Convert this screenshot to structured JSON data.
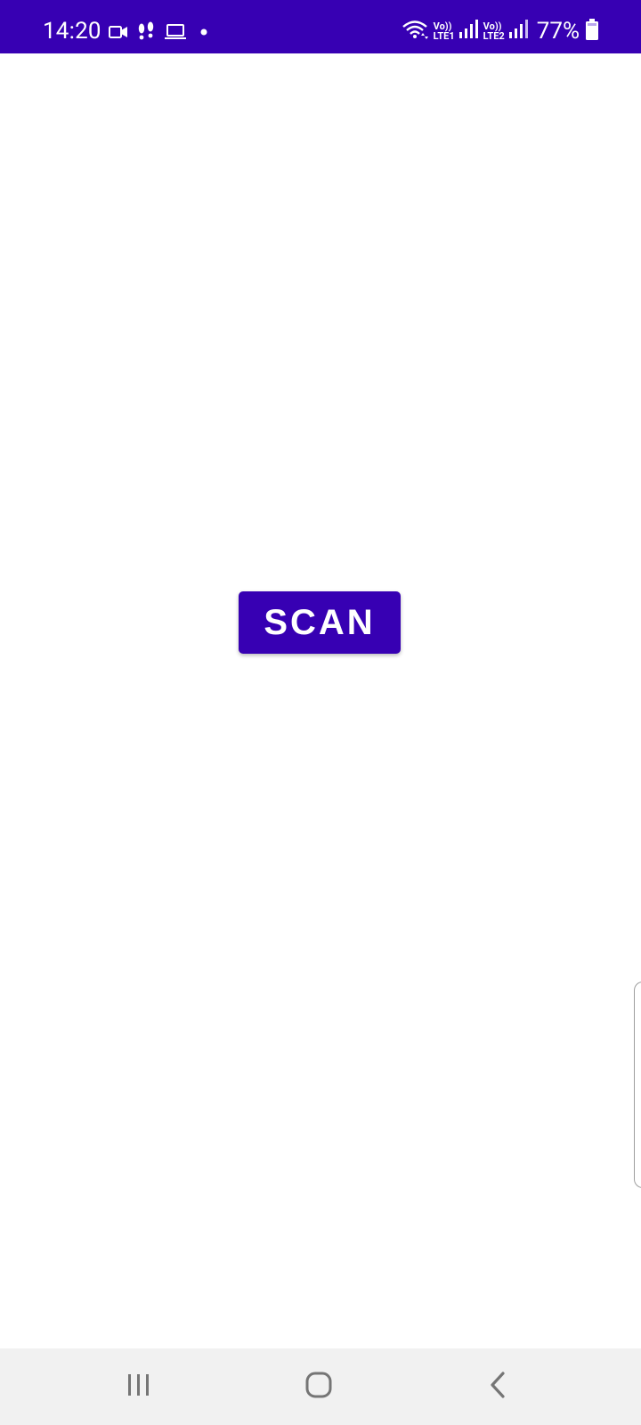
{
  "status_bar": {
    "time": "14:20",
    "lte1_top": "Vo))",
    "lte1_bottom": "LTE1",
    "lte2_top": "Vo))",
    "lte2_bottom": "LTE2",
    "battery_percent": "77%",
    "background": "#3700B3",
    "icons": [
      "video-camera-icon",
      "footsteps-icon",
      "laptop-icon",
      "dot-icon",
      "wifi-icon",
      "signal-icon",
      "battery-icon"
    ]
  },
  "main": {
    "scan_label": "SCAN",
    "button_color": "#3700B3"
  },
  "nav_bar": {
    "icons": [
      "recents-icon",
      "home-icon",
      "back-icon"
    ]
  }
}
